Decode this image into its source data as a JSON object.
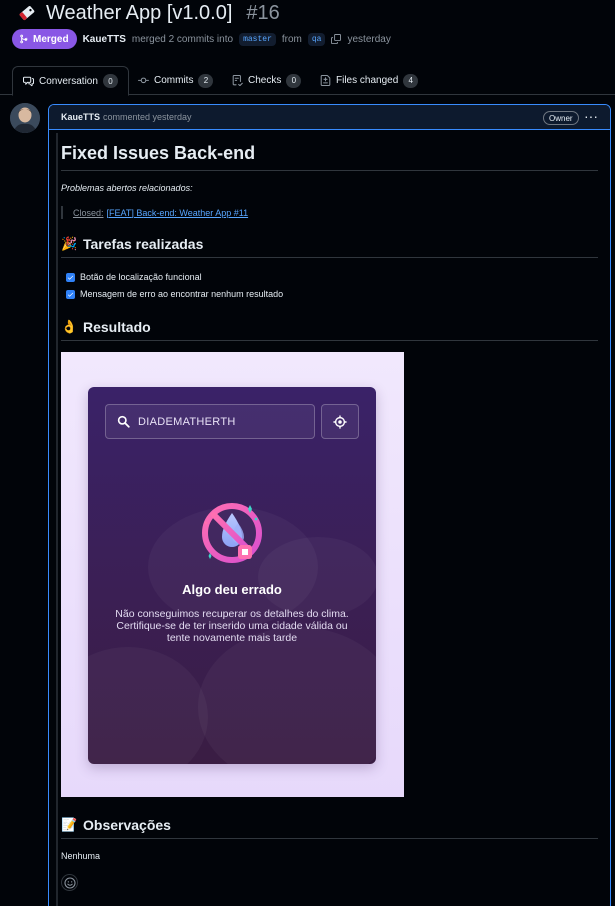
{
  "header": {
    "title": "Weather App [v1.0.0]",
    "number": "#16",
    "status": "Merged",
    "author": "KaueTTS",
    "merge_text": "merged 2 commits into",
    "base_branch": "master",
    "from_text": "from",
    "head_branch": "qa",
    "time": "yesterday"
  },
  "tabs": [
    {
      "label": "Conversation",
      "count": "0",
      "icon": "comment-icon"
    },
    {
      "label": "Commits",
      "count": "2",
      "icon": "commit-icon"
    },
    {
      "label": "Checks",
      "count": "0",
      "icon": "checks-icon"
    },
    {
      "label": "Files changed",
      "count": "4",
      "icon": "file-diff-icon"
    }
  ],
  "comment": {
    "author": "KaueTTS",
    "action": "commented yesterday",
    "badge": "Owner",
    "heading": "Fixed Issues Back-end",
    "related_label": "Problemas abertos relacionados:",
    "quote_prefix": "Closed:",
    "quote_link": "[FEAT] Back-end: Weather App #11",
    "tasks_heading": "Tarefas realizadas",
    "tasks": [
      "Botão de localização funcional",
      "Mensagem de erro ao encontrar nenhum resultado"
    ],
    "result_heading": "Resultado",
    "notes_heading": "Observações",
    "notes_text": "Nenhuma"
  },
  "screenshot": {
    "search_value": "DIADEMATHERTH",
    "error_title": "Algo deu errado",
    "error_message": "Não conseguimos recuperar os detalhes do clima. Certifique-se de ter inserido uma cidade válida ou tente novamente mais tarde"
  },
  "colors": {
    "merged": "#8957e5",
    "link": "#58a6ff",
    "border_active": "#388bfd",
    "background": "#010409"
  }
}
